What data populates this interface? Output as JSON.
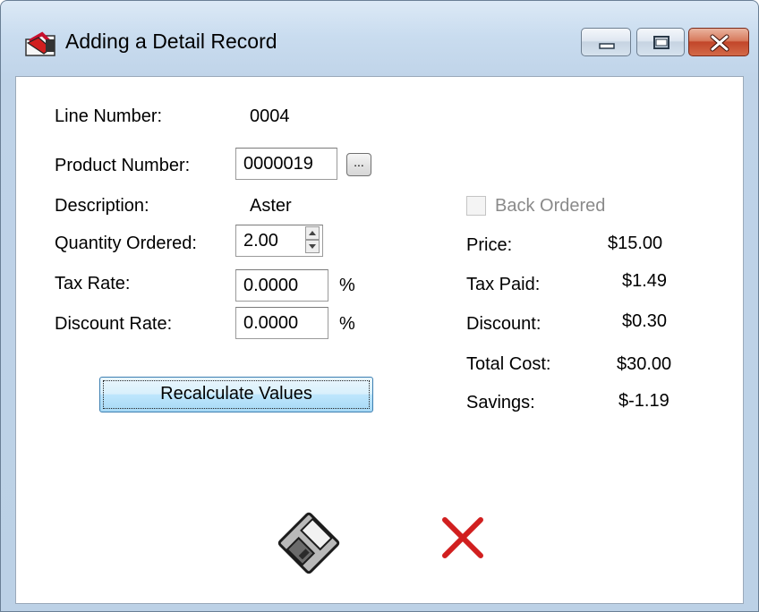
{
  "window": {
    "title": "Adding a Detail Record",
    "icon": "app-folder-icon"
  },
  "form": {
    "line_number_label": "Line Number:",
    "line_number_value": "0004",
    "product_number_label": "Product Number:",
    "product_number_value": "0000019",
    "browse_button_label": "...",
    "description_label": "Description:",
    "description_value": "Aster",
    "quantity_label": "Quantity Ordered:",
    "quantity_value": "2.00",
    "tax_rate_label": "Tax Rate:",
    "tax_rate_value": "0.0000",
    "tax_rate_unit": "%",
    "discount_rate_label": "Discount Rate:",
    "discount_rate_value": "0.0000",
    "discount_rate_unit": "%",
    "recalculate_label": "Recalculate Values"
  },
  "summary": {
    "back_ordered_label": "Back Ordered",
    "back_ordered_checked": false,
    "price_label": "Price:",
    "price_value": "$15.00",
    "tax_paid_label": "Tax Paid:",
    "tax_paid_value": "$1.49",
    "discount_label": "Discount:",
    "discount_value": "$0.30",
    "total_cost_label": "Total Cost:",
    "total_cost_value": "$30.00",
    "savings_label": "Savings:",
    "savings_value": "$-1.19"
  },
  "actions": {
    "save_icon": "floppy-disk-icon",
    "cancel_icon": "red-x-icon"
  },
  "colors": {
    "cancel_red": "#d11f1f",
    "title_bar": "#c9dcef",
    "close_button": "#c2462a"
  }
}
